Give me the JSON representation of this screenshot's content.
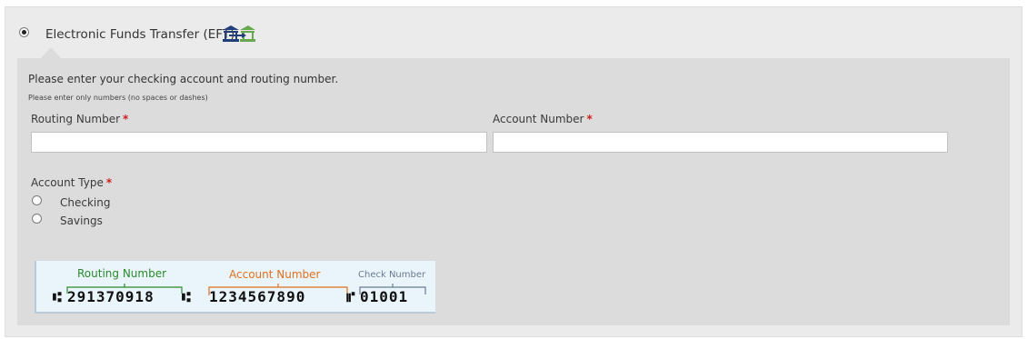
{
  "payment_option": {
    "label": "Electronic Funds Transfer (EFT)",
    "selected": true,
    "icon": "bank-transfer-icon"
  },
  "panel": {
    "instruction": "Please enter your checking account and routing number.",
    "instruction_small": "Please enter only numbers (no spaces or dashes)",
    "required_marker": "*"
  },
  "routing": {
    "label": "Routing Number",
    "value": ""
  },
  "account": {
    "label": "Account Number",
    "value": ""
  },
  "account_type": {
    "label": "Account Type",
    "options": [
      "Checking",
      "Savings"
    ]
  },
  "check_diagram": {
    "routing_label": "Routing Number",
    "account_label": "Account Number",
    "check_label": "Check Number",
    "routing_digits": "291370918",
    "account_digits": "1234567890",
    "check_digits": "01001",
    "colors": {
      "routing": "#2b8a2b",
      "account": "#e0701f",
      "check": "#6a7a8e"
    }
  }
}
